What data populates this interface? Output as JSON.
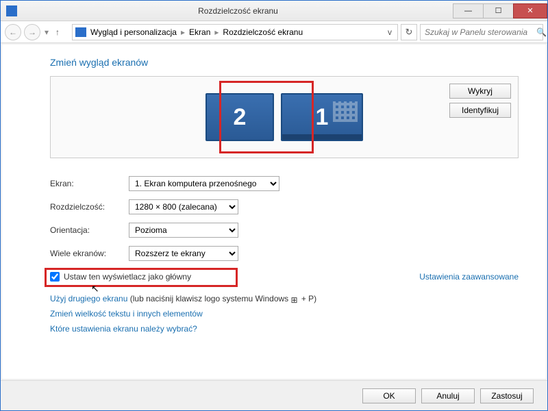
{
  "window": {
    "title": "Rozdzielczość ekranu"
  },
  "breadcrumb": {
    "root": "Wygląd i personalizacja",
    "mid": "Ekran",
    "leaf": "Rozdzielczość ekranu"
  },
  "search": {
    "placeholder": "Szukaj w Panelu sterowania"
  },
  "heading": "Zmień wygląd ekranów",
  "monitors": {
    "m1": "1",
    "m2": "2"
  },
  "buttons": {
    "detect": "Wykryj",
    "identify": "Identyfikuj",
    "ok": "OK",
    "cancel": "Anuluj",
    "apply": "Zastosuj"
  },
  "labels": {
    "display": "Ekran:",
    "resolution": "Rozdzielczość:",
    "orientation": "Orientacja:",
    "multiple": "Wiele ekranów:"
  },
  "values": {
    "display": "1. Ekran komputera przenośnego",
    "resolution": "1280 × 800 (zalecana)",
    "orientation": "Pozioma",
    "multiple": "Rozszerz te ekrany"
  },
  "checkbox": {
    "label": "Ustaw ten wyświetlacz jako główny"
  },
  "advanced": "Ustawienia zaawansowane",
  "links": {
    "second_a": "Użyj drugiego ekranu",
    "second_b": " (lub naciśnij klawisz logo systemu Windows ",
    "second_c": " + P)",
    "textsize": "Zmień wielkość tekstu i innych elementów",
    "which": "Które ustawienia ekranu należy wybrać?"
  }
}
